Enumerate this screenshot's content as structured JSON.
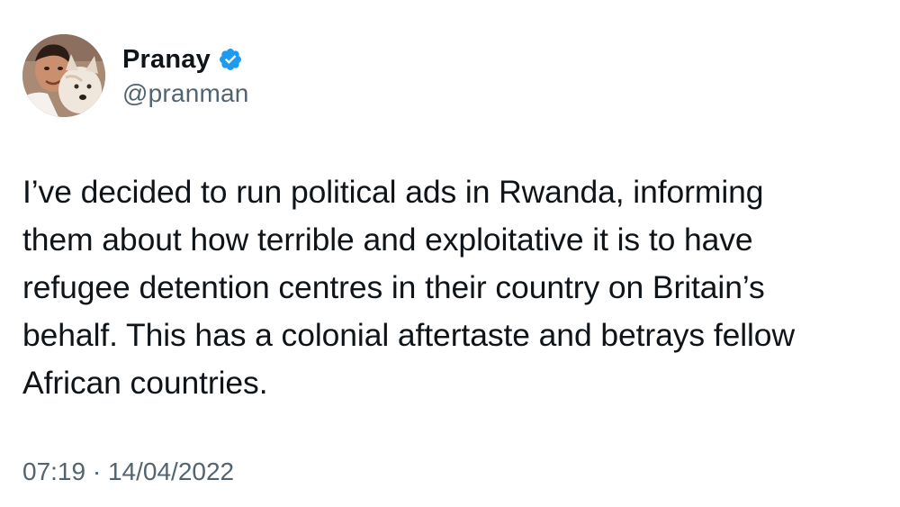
{
  "author": {
    "display_name": "Pranay",
    "handle": "@pranman",
    "verified": true,
    "verified_color": "#1d9bf0",
    "avatar_icon": "profile-photo-with-dog"
  },
  "tweet": {
    "lines": [
      "I’ve decided to run political ads in Rwanda, informing",
      "them about how terrible and exploitative it is to have",
      "refugee detention centres in their country on Britain’s",
      "behalf. This has a colonial aftertaste and betrays fellow",
      "African countries."
    ],
    "time": "07:19",
    "separator": "·",
    "date": "14/04/2022"
  },
  "colors": {
    "text": "#0f1419",
    "secondary_text": "#536471",
    "background": "#ffffff"
  }
}
